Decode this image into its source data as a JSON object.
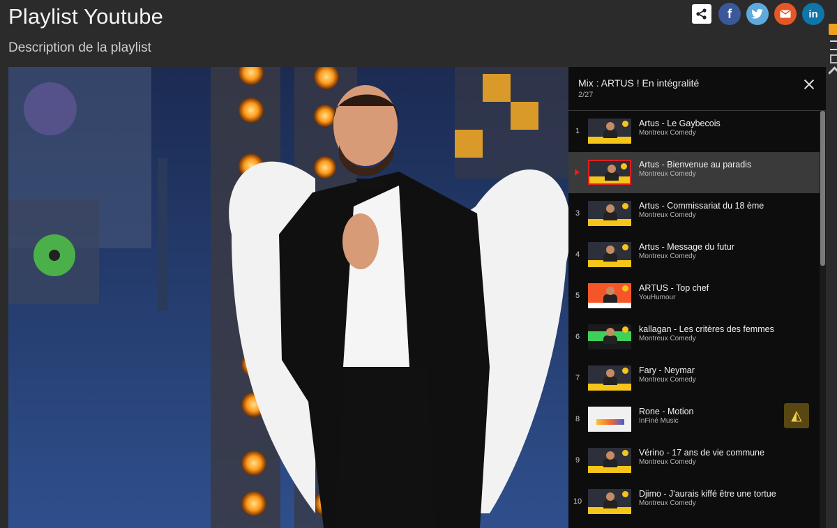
{
  "page": {
    "title": "Playlist Youtube",
    "description": "Description de la playlist"
  },
  "share": {
    "icons": [
      "share-icon",
      "facebook-icon",
      "twitter-icon",
      "mail-icon",
      "linkedin-icon"
    ],
    "facebook_glyph": "f",
    "linkedin_glyph": "in",
    "colors": {
      "facebook": "#3b5998",
      "twitter": "#5ea9dd",
      "mail": "#e65725",
      "linkedin": "#0e76a8"
    }
  },
  "playlist": {
    "title": "Mix : ARTUS ! En intégralité",
    "position": "2/27",
    "active_index": 1,
    "items": [
      {
        "index": "1",
        "title": "Artus - Le Gaybecois",
        "channel": "Montreux Comedy"
      },
      {
        "index": "",
        "title": "Artus - Bienvenue au paradis",
        "channel": "Montreux Comedy"
      },
      {
        "index": "3",
        "title": "Artus - Commissariat du 18 ème",
        "channel": "Montreux Comedy"
      },
      {
        "index": "4",
        "title": "Artus - Message du futur",
        "channel": "Montreux Comedy"
      },
      {
        "index": "5",
        "title": "ARTUS - Top chef",
        "channel": "YouHumour"
      },
      {
        "index": "6",
        "title": "kallagan - Les critères des femmes",
        "channel": "Montreux Comedy"
      },
      {
        "index": "7",
        "title": "Fary - Neymar",
        "channel": "Montreux Comedy"
      },
      {
        "index": "8",
        "title": "Rone - Motion",
        "channel": "InFiné Music"
      },
      {
        "index": "9",
        "title": "Vérino - 17 ans de vie commune",
        "channel": "Montreux Comedy"
      },
      {
        "index": "10",
        "title": "Djimo - J'aurais kiffé être une tortue",
        "channel": "Montreux Comedy"
      }
    ]
  },
  "colors": {
    "accent_red": "#e02020",
    "background": "#2b2b2b"
  }
}
